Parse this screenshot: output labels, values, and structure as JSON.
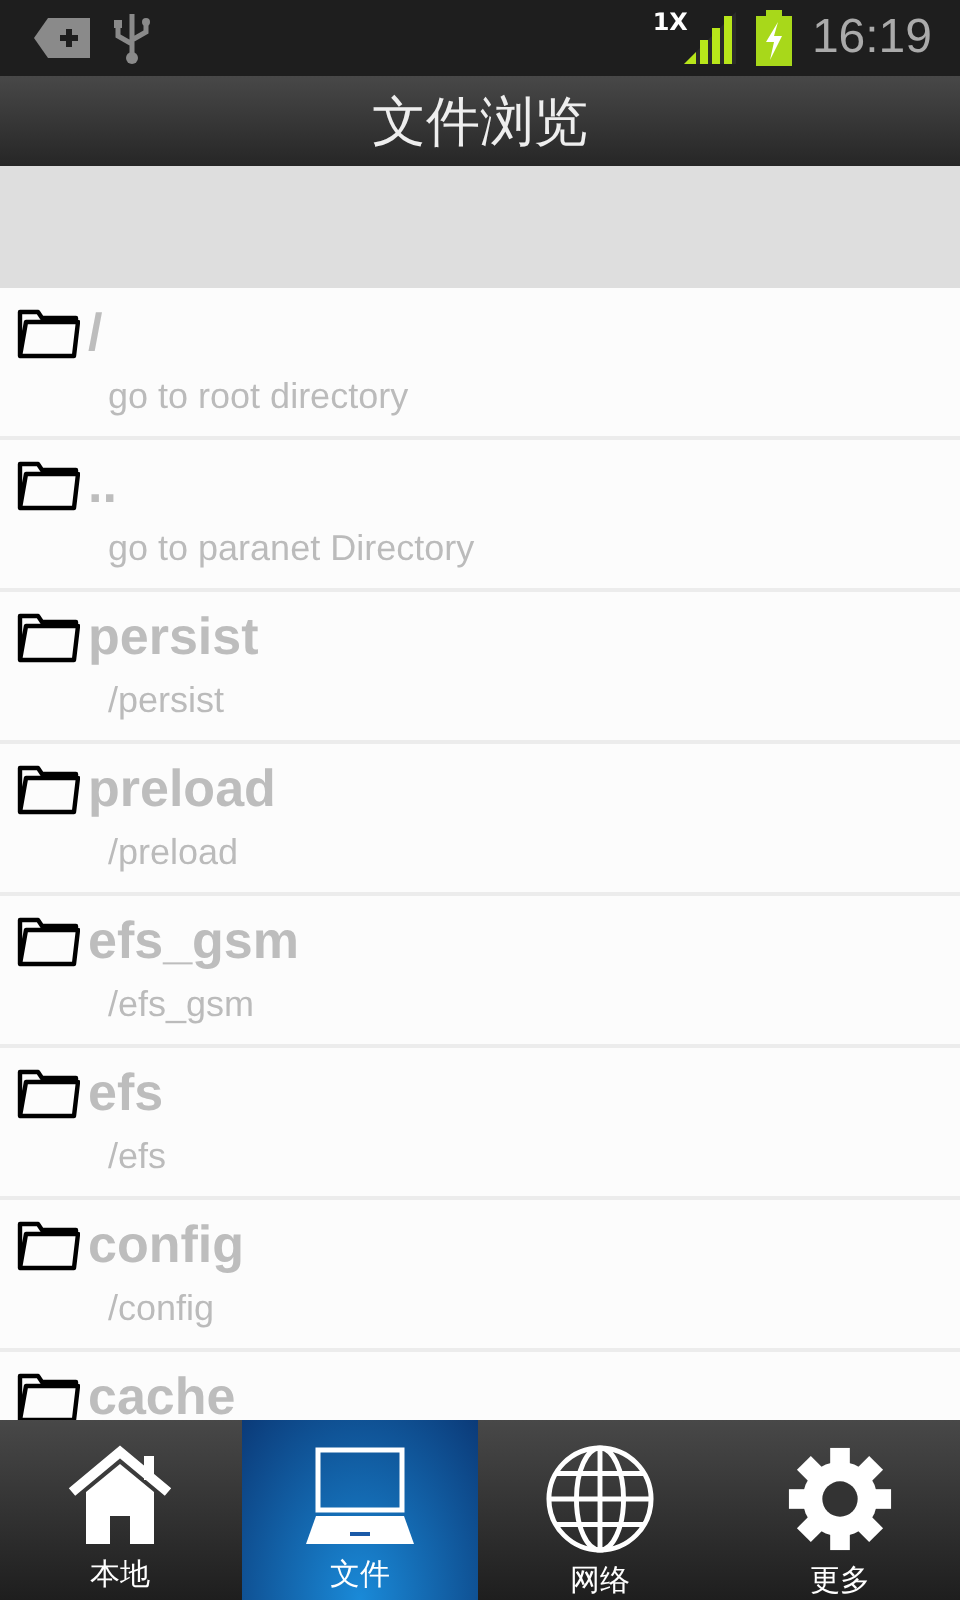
{
  "status_bar": {
    "network": "1X",
    "time": "16:19"
  },
  "title": "文件浏览",
  "files": [
    {
      "name": "/",
      "path": "go to root directory"
    },
    {
      "name": "..",
      "path": "go to paranet Directory"
    },
    {
      "name": "persist",
      "path": "/persist"
    },
    {
      "name": "preload",
      "path": "/preload"
    },
    {
      "name": "efs_gsm",
      "path": "/efs_gsm"
    },
    {
      "name": "efs",
      "path": "/efs"
    },
    {
      "name": "config",
      "path": "/config"
    },
    {
      "name": "cache"
    }
  ],
  "tabs": [
    {
      "label": "本地",
      "kind": "home",
      "selected": false
    },
    {
      "label": "文件",
      "kind": "laptop",
      "selected": true
    },
    {
      "label": "网络",
      "kind": "globe",
      "selected": false
    },
    {
      "label": "更多",
      "kind": "gear",
      "selected": false
    }
  ]
}
